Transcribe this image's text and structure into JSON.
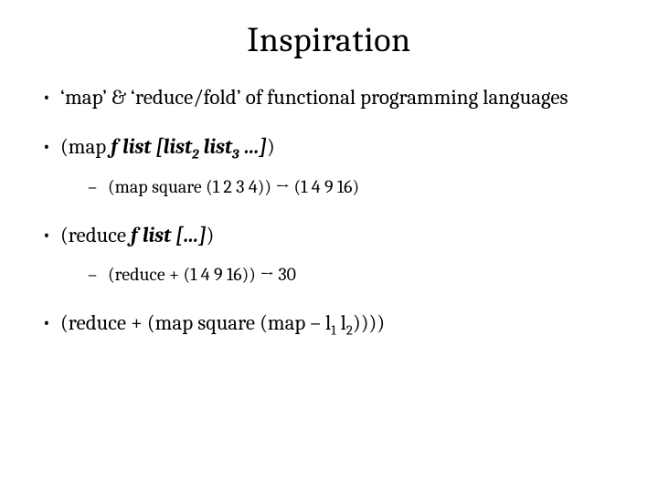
{
  "title": "Inspiration",
  "bullets": {
    "b1": "‘map’ & ‘reduce/fold’ of functional programming languages",
    "b2": {
      "open": "(map ",
      "arg": "f list [list",
      "sub2": "2",
      "mid": " list",
      "sub3": "3",
      "close": " …]",
      "paren": ")"
    },
    "b2s": "(map square (1 2 3 4)) → (1 4 9 16)",
    "b3": {
      "open": "(reduce ",
      "arg": "f list […]",
      "paren": ")"
    },
    "b3s": "(reduce + (1 4 9 16)) → 30",
    "b4": {
      "a": "(reduce + (map square (map – l",
      "sub1": "1",
      "b": " l",
      "sub2": "2",
      "c": "))))"
    }
  }
}
